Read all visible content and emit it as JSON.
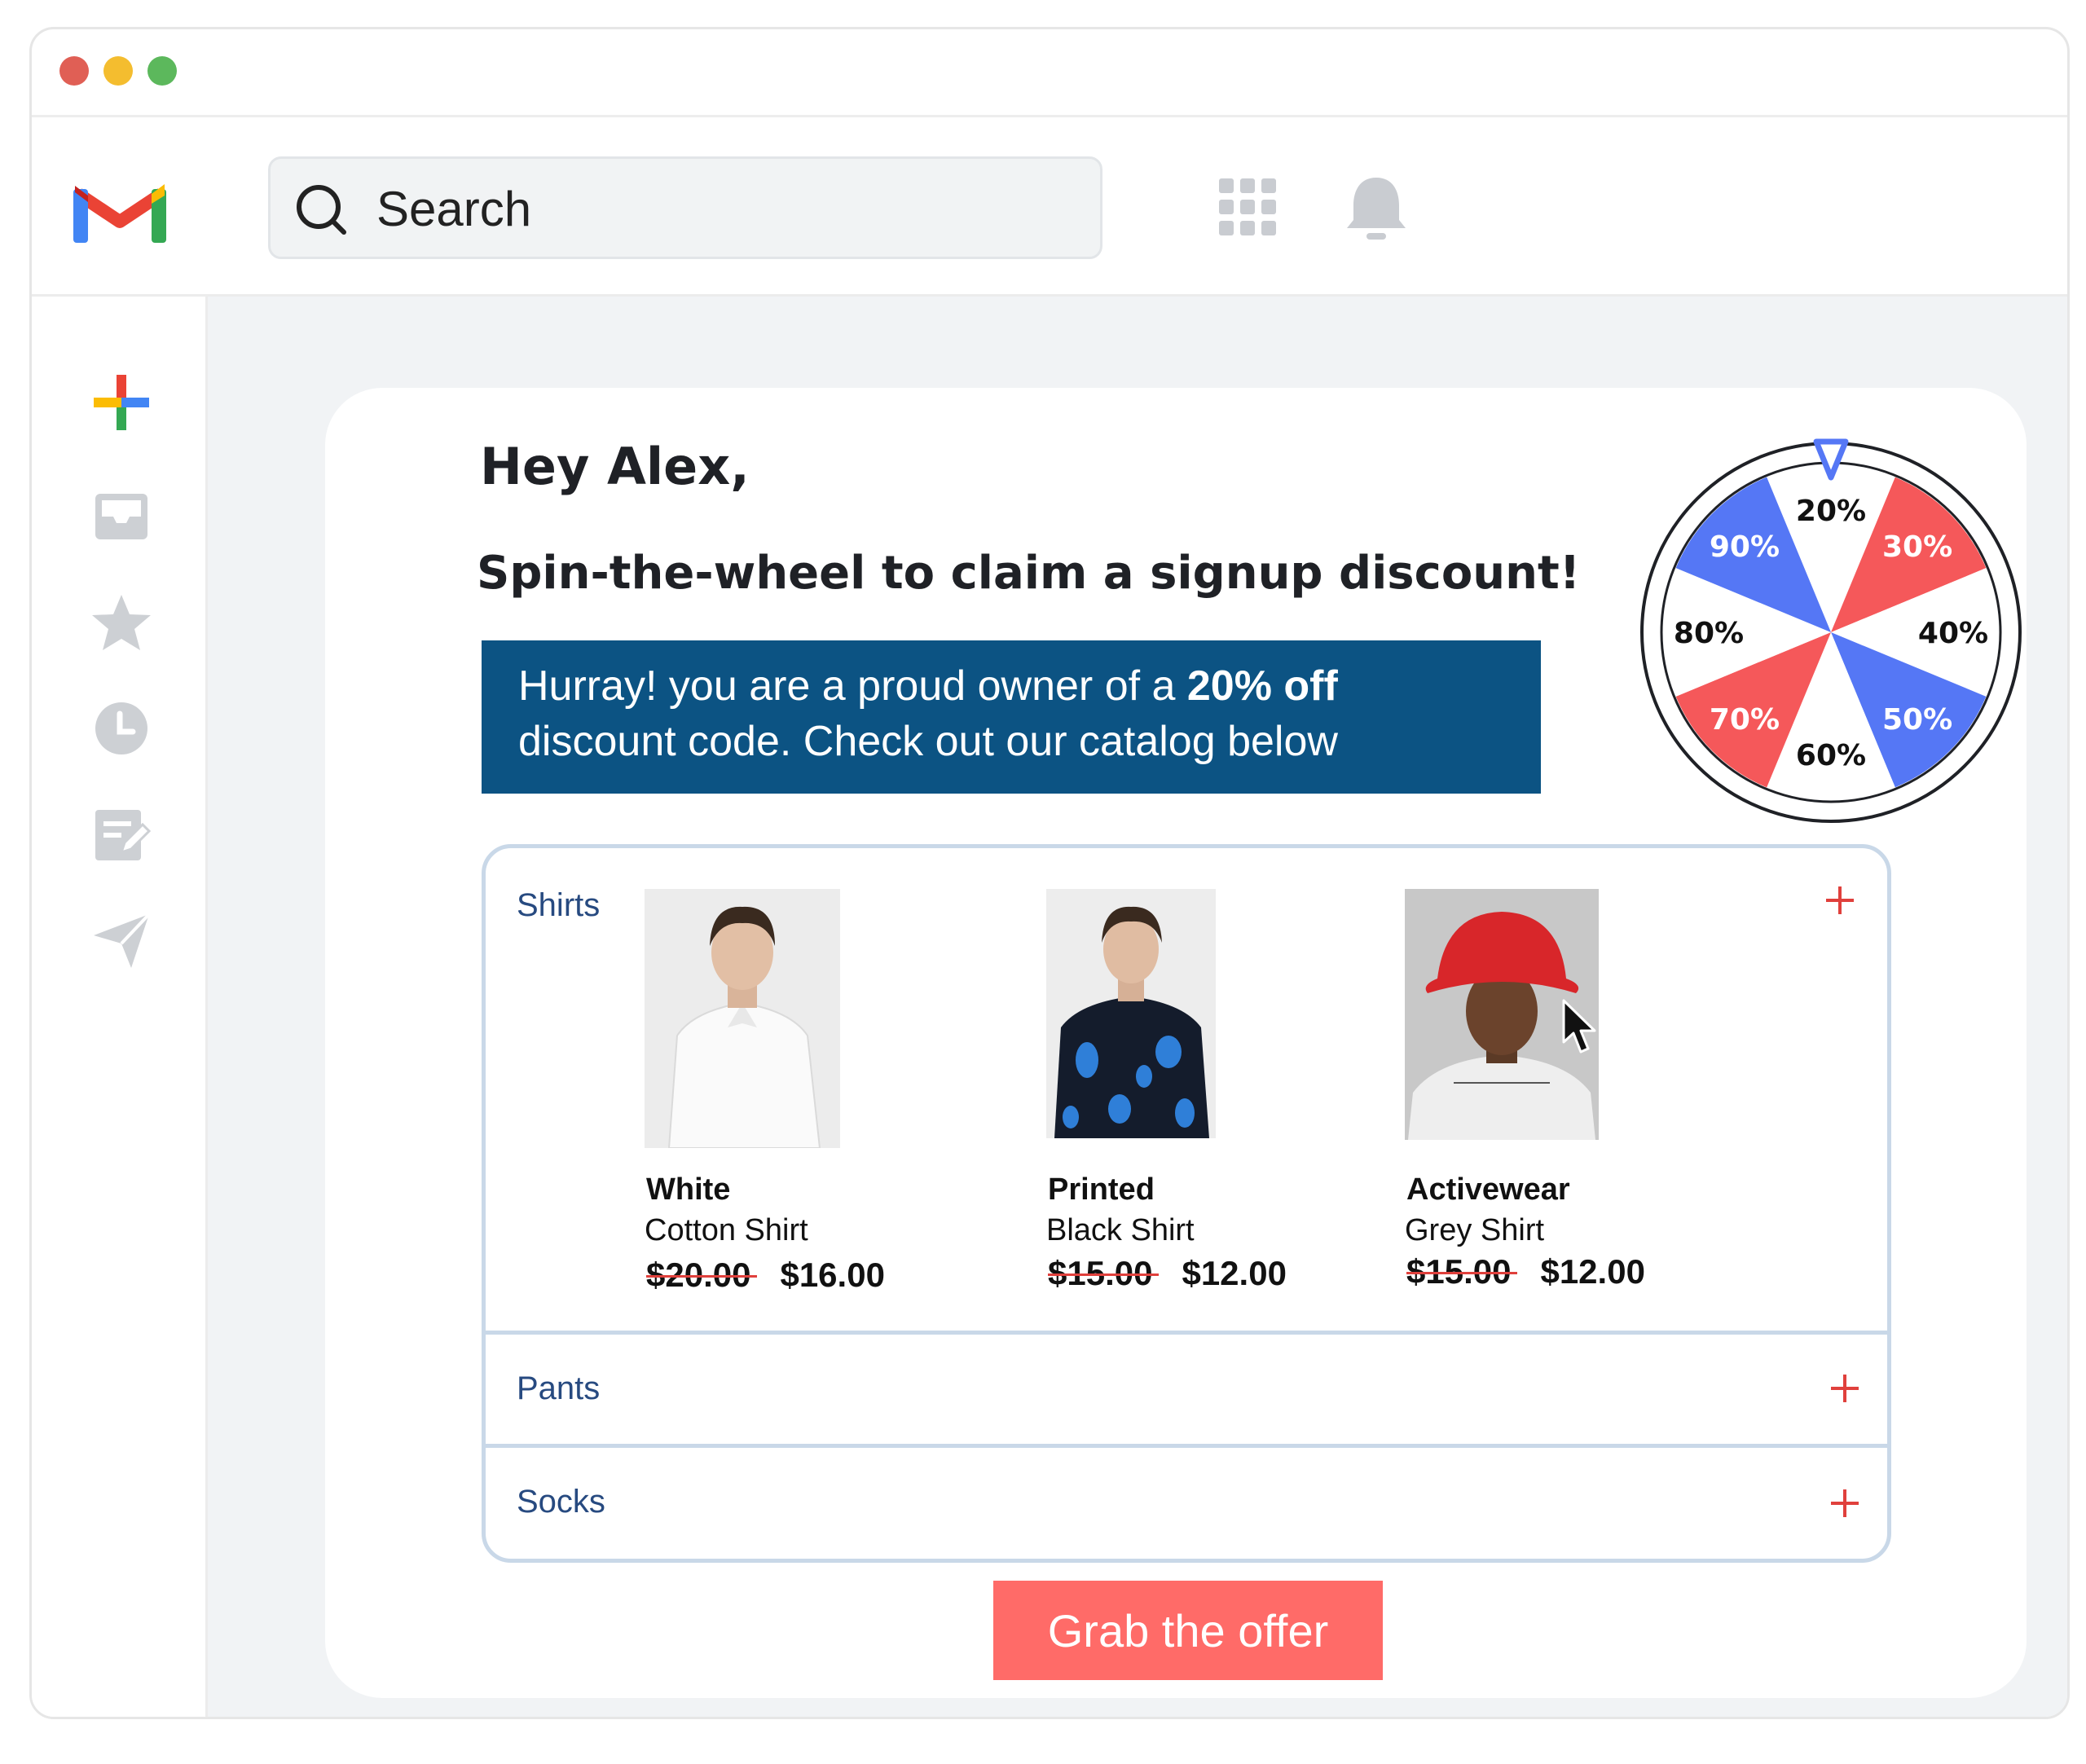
{
  "window": {
    "dots": [
      "#e05f55",
      "#f4bd2f",
      "#5cb85c"
    ]
  },
  "toolbar": {
    "search_placeholder": "Search",
    "logo_colors": [
      "#4285f4",
      "#ea4335",
      "#fbbc04",
      "#34a853"
    ]
  },
  "sidebar": {
    "items": [
      {
        "icon": "plus-compose-icon"
      },
      {
        "icon": "inbox-icon"
      },
      {
        "icon": "star-icon"
      },
      {
        "icon": "clock-icon"
      },
      {
        "icon": "drafts-icon"
      },
      {
        "icon": "send-icon"
      }
    ]
  },
  "email": {
    "greeting": "Hey Alex,",
    "subtitle": "Spin-the-wheel to claim a signup discount!",
    "banner_text_1": "Hurray! you are a proud owner of a ",
    "banner_bold": "20% off",
    "banner_text_2": "discount code. Check out our catalog below",
    "banner_color": "#0c5383"
  },
  "wheel": {
    "segments": [
      {
        "label": "20%",
        "color": "#ffffff"
      },
      {
        "label": "30%",
        "color": "#f5585a"
      },
      {
        "label": "40%",
        "color": "#ffffff"
      },
      {
        "label": "50%",
        "color": "#5577f5"
      },
      {
        "label": "60%",
        "color": "#ffffff"
      },
      {
        "label": "70%",
        "color": "#f5585a"
      },
      {
        "label": "80%",
        "color": "#ffffff"
      },
      {
        "label": "90%",
        "color": "#5577f5"
      }
    ],
    "pointer_color": "#5577f5"
  },
  "catalog": {
    "sections": [
      {
        "label": "Shirts"
      },
      {
        "label": "Pants"
      },
      {
        "label": "Socks"
      }
    ],
    "products": [
      {
        "name_bold": "White",
        "name": "Cotton Shirt",
        "old_price": "$20.00",
        "price": "$16.00"
      },
      {
        "name_bold": "Printed",
        "name": "Black Shirt",
        "old_price": "$15.00",
        "price": "$12.00"
      },
      {
        "name_bold": "Activewear",
        "name": "Grey Shirt",
        "old_price": "$15.00",
        "price": "$12.00"
      }
    ],
    "accent_color": "#e0403c"
  },
  "cta": {
    "label": "Grab the offer",
    "color": "#ff6b68"
  }
}
